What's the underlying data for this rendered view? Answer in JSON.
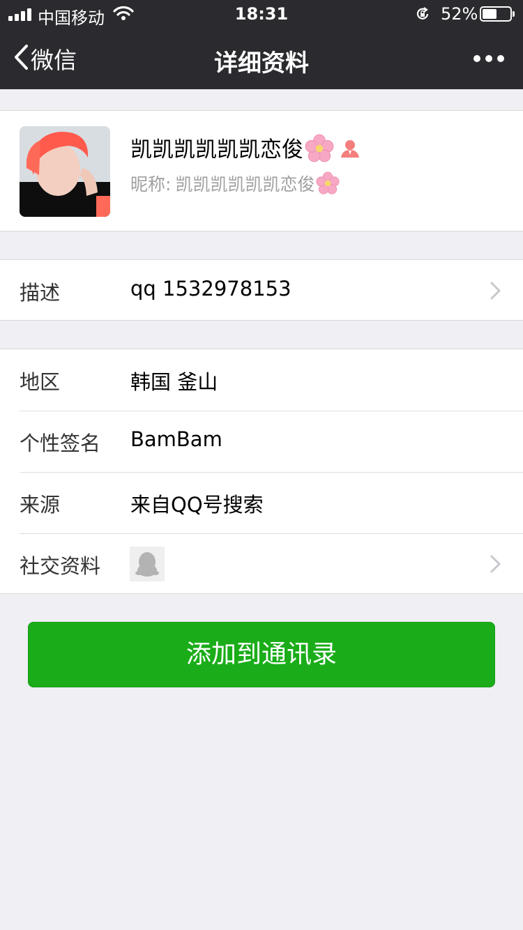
{
  "status_bar": {
    "carrier": "中国移动",
    "time": "18:31",
    "battery_percent": "52%",
    "battery_level": 0.52
  },
  "nav": {
    "back_label": "微信",
    "title": "详细资料",
    "more_icon": "more-dots-icon"
  },
  "profile": {
    "name": "凯凯凯凯凯凯恋俊",
    "nickname_label": "昵称:",
    "nickname": "凯凯凯凯凯凯恋俊",
    "name_emoji": "cherry-blossom-icon",
    "gender_icon": "female-icon",
    "colors": {
      "female": "#f37e7d",
      "blossom": "#f7a8c4"
    }
  },
  "description": {
    "label": "描述",
    "value": "qq 1532978153"
  },
  "info_rows": [
    {
      "label": "地区",
      "value": "韩国 釜山"
    },
    {
      "label": "个性签名",
      "value": "BamBam"
    },
    {
      "label": "来源",
      "value": "来自QQ号搜索"
    },
    {
      "label": "社交资料",
      "value": ""
    }
  ],
  "add_button_label": "添加到通讯录",
  "colors": {
    "header": "#2b2b2f",
    "background": "#efeff4",
    "primary_button": "#1aad19"
  }
}
